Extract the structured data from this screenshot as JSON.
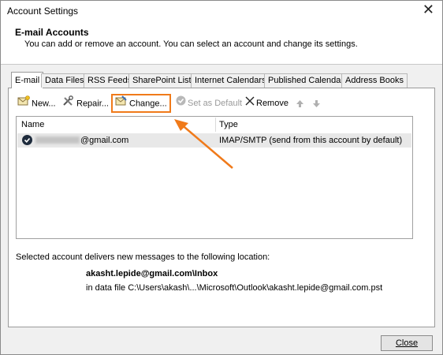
{
  "window": {
    "title": "Account Settings",
    "close_glyph": "✕"
  },
  "header": {
    "title": "E-mail Accounts",
    "description": "You can add or remove an account. You can select an account and change its settings."
  },
  "tabs": [
    {
      "label": "E-mail",
      "active": true
    },
    {
      "label": "Data Files"
    },
    {
      "label": "RSS Feeds"
    },
    {
      "label": "SharePoint Lists"
    },
    {
      "label": "Internet Calendars"
    },
    {
      "label": "Published Calendars"
    },
    {
      "label": "Address Books"
    }
  ],
  "toolbar": {
    "new_label": "New...",
    "repair_label": "Repair...",
    "change_label": "Change...",
    "set_default_label": "Set as Default",
    "remove_label": "Remove"
  },
  "list": {
    "columns": [
      "Name",
      "Type"
    ],
    "rows": [
      {
        "name": "@gmail.com",
        "type": "IMAP/SMTP (send from this account by default)"
      }
    ]
  },
  "delivery": {
    "label": "Selected account delivers new messages to the following location:",
    "location": "akasht.lepide@gmail.com\\Inbox",
    "file": "in data file C:\\Users\\akash\\...\\Microsoft\\Outlook\\akasht.lepide@gmail.com.pst"
  },
  "footer": {
    "close_label": "Close"
  },
  "colors": {
    "annotation": "#f07a1a",
    "selected_row": "#e8e8e8"
  }
}
